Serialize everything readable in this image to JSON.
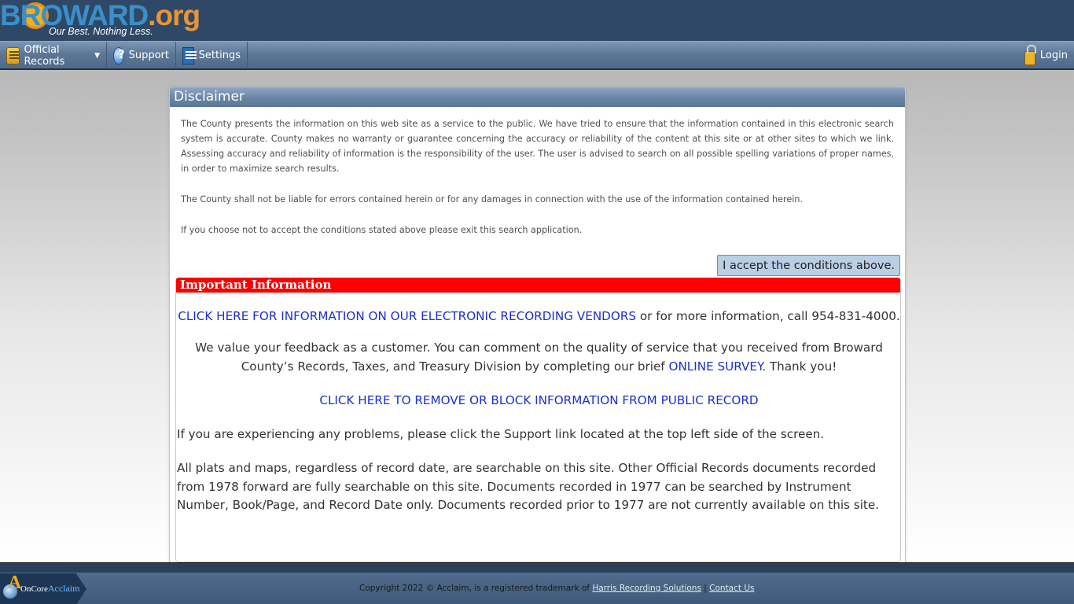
{
  "header": {
    "logo_main": "BROWARD",
    "logo_org": ".org",
    "logo_tagline": "Our Best. Nothing Less."
  },
  "nav": {
    "official_records": "Official Records",
    "support": "Support",
    "settings": "Settings",
    "login": "Login"
  },
  "disclaimer": {
    "title": "Disclaimer",
    "paragraphs": [
      "The County presents the information on this web site as a service to the public. We have tried to ensure that the information contained in this electronic search system is accurate. County makes no warranty or guarantee concerning the accuracy or reliability of the content at this site or at other sites to which we link. Assessing accuracy and reliability of information is the responsibility of the user. The user is advised to search on all possible spelling variations of proper names, in order to maximize search results.",
      "The County shall not be liable for errors contained herein or for any damages in connection with the use of the information contained herein.",
      "If you choose not to accept the conditions stated above please exit this search application."
    ],
    "accept_button": "I accept the conditions above."
  },
  "important": {
    "title": "Important Information",
    "vendors_link": "CLICK HERE FOR INFORMATION ON OUR ELECTRONIC RECORDING VENDORS",
    "vendors_suffix": " or for more information, call 954-831-4000.",
    "feedback_prefix": "We value your feedback as a customer. You can comment on the quality of service that you received from Broward County’s Records, Taxes, and Treasury Division by completing our brief ",
    "survey_link": "ONLINE SURVEY",
    "feedback_suffix": ". Thank you!",
    "remove_link": "CLICK HERE TO REMOVE OR BLOCK INFORMATION FROM PUBLIC RECORD",
    "problems_text": "If you are experiencing any problems, please click the Support link located at the top left side of the screen.",
    "plats_text": "All plats and maps, regardless of record date, are searchable on this site. Other Official Records documents recorded from 1978 forward are fully searchable on this site. Documents recorded in 1977 can be searched by Instrument Number, Book/Page, and Record Date only. Documents recorded prior to 1977 are not currently available on this site."
  },
  "footer": {
    "oncore": "OnCore",
    "acclaim": "Acclaim",
    "copyright": "Copyright 2022 © Acclaim, is a registered trademark of ",
    "harris_link": "Harris Recording Solutions",
    "separator": " | ",
    "contact_link": "Contact Us"
  }
}
